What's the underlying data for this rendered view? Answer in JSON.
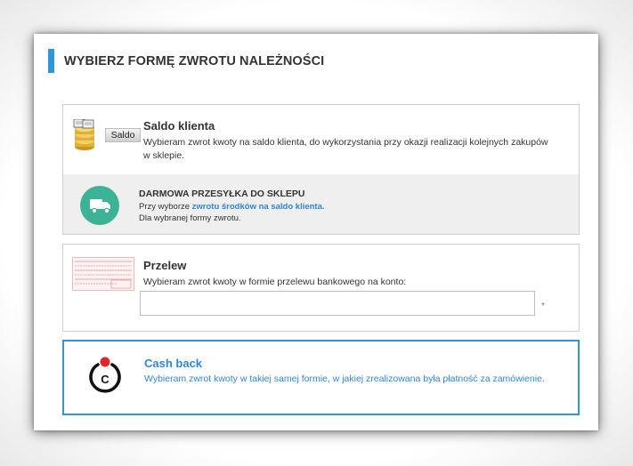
{
  "heading": "WYBIERZ FORMĘ ZWROTU NALEŻNOŚCI",
  "colors": {
    "accent": "#2f96db",
    "promo_icon": "#3bb394",
    "cashback_dot": "#e0262b",
    "link": "#2f86d6"
  },
  "options": {
    "saldo": {
      "icon_label": "Saldo",
      "title": "Saldo klienta",
      "desc_line1": "Wybieram zwrot kwoty na saldo klienta, do wykorzystania przy okazji realizacji kolejnych zakupów",
      "desc_line2": "w sklepie.",
      "promo": {
        "title": "DARMOWA PRZESYŁKA DO SKLEPU",
        "line1_prefix": "Przy wyborze ",
        "line1_link": "zwrotu środków na saldo klienta.",
        "line2": "Dla wybranej formy zwrotu."
      }
    },
    "przelew": {
      "title": "Przelew",
      "desc": "Wybieram zwrot kwoty w formie przelewu bankowego na konto:",
      "account_value": "",
      "required_mark": "*"
    },
    "cashback": {
      "title": "Cash back",
      "desc": "Wybieram zwrot kwoty w takiej samej formie, w jakiej zrealizowana była płatność za zamówienie.",
      "icon_letter": "C",
      "selected": true
    }
  }
}
